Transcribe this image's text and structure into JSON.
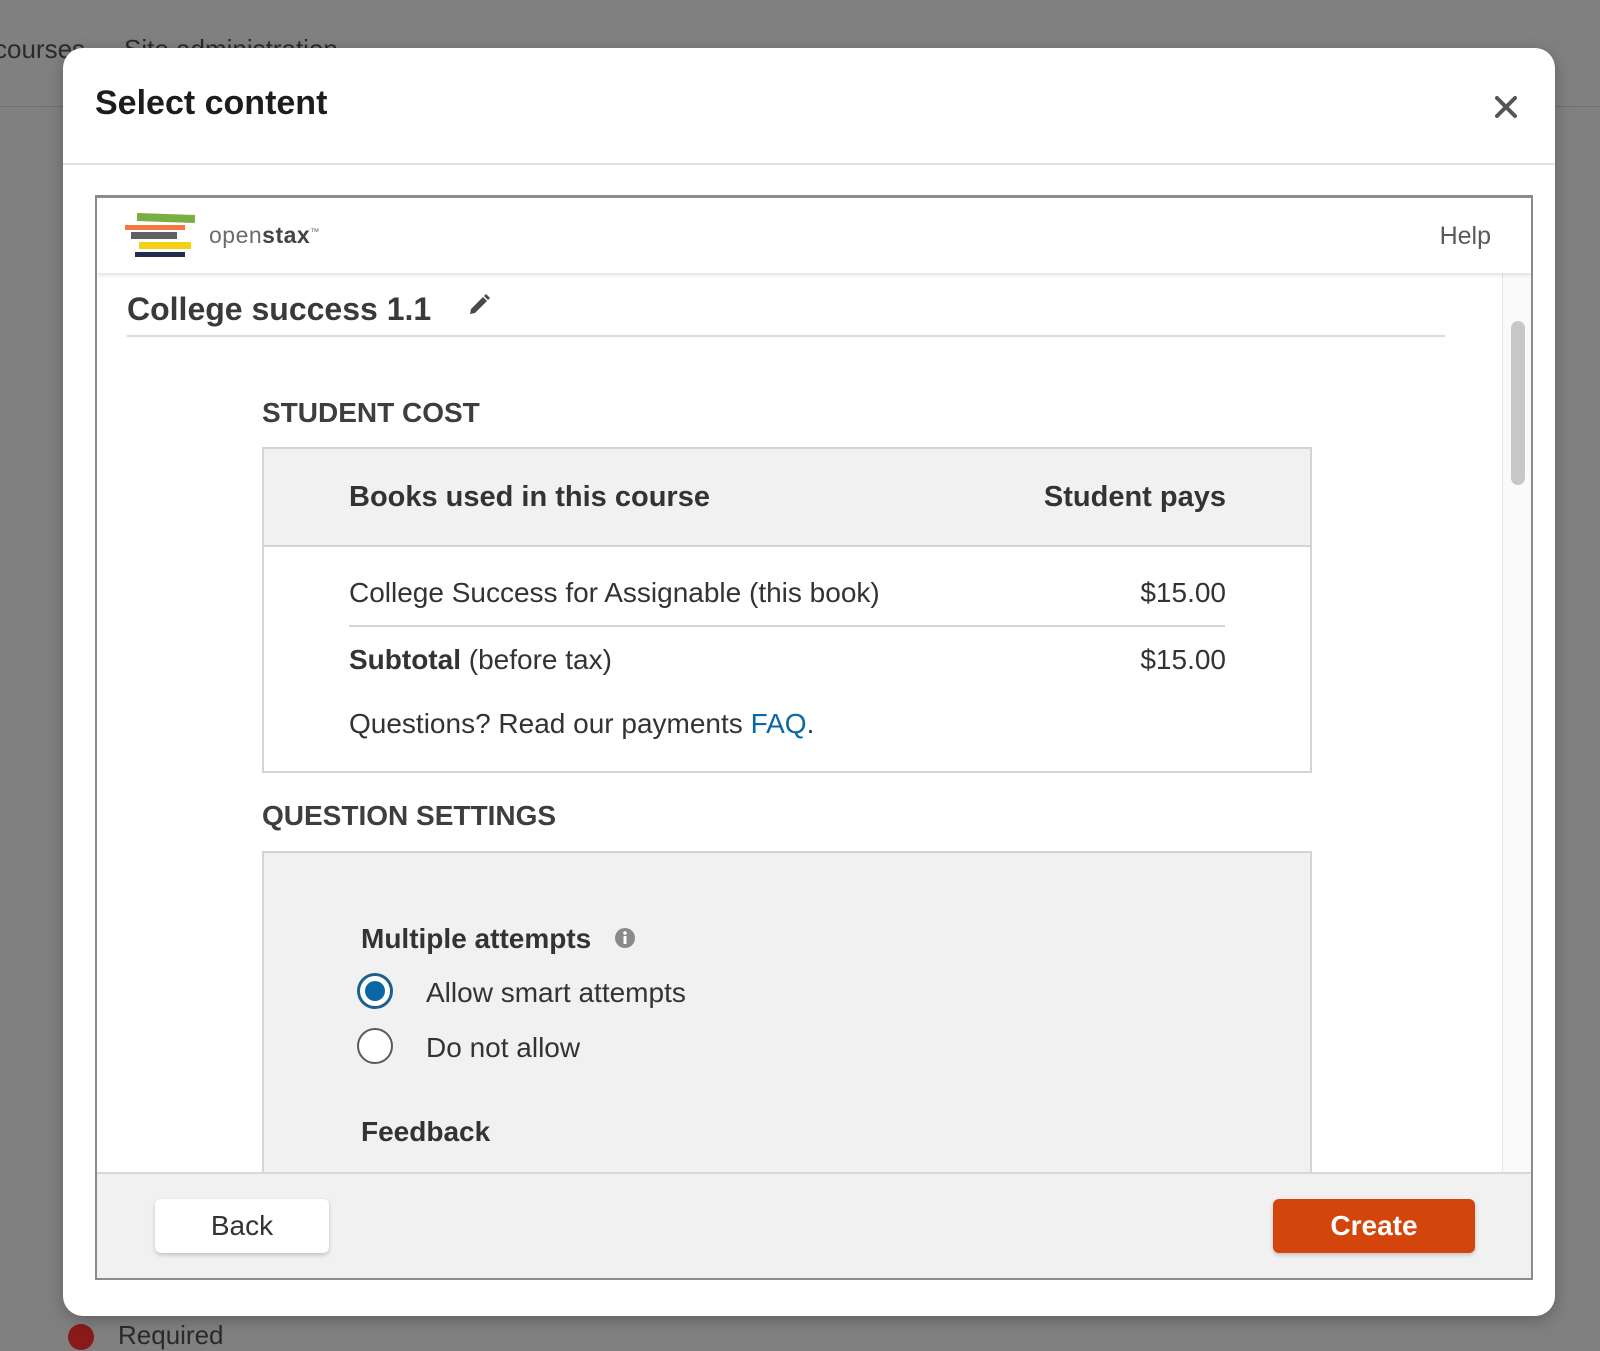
{
  "background": {
    "nav_items": [
      "courses",
      "Site administration"
    ],
    "required_note": "Required"
  },
  "modal": {
    "title": "Select content",
    "close_icon": "close-icon"
  },
  "openstax": {
    "logo_text_light": "open",
    "logo_text_bold": "stax",
    "trademark": "™",
    "help_label": "Help"
  },
  "course": {
    "title": "College success 1.1",
    "edit_icon": "pencil-icon"
  },
  "student_cost": {
    "heading": "STUDENT COST",
    "columns": [
      "Books used in this course",
      "Student pays"
    ],
    "rows": [
      {
        "book": "College Success for Assignable (this book)",
        "price": "$15.00"
      }
    ],
    "subtotal_label": "Subtotal",
    "subtotal_suffix": " (before tax)",
    "subtotal_value": "$15.00",
    "questions_text": "Questions? Read our payments ",
    "faq_label": "FAQ",
    "faq_suffix": "."
  },
  "question_settings": {
    "heading": "QUESTION SETTINGS",
    "multiple_attempts_label": "Multiple attempts",
    "options": [
      {
        "label": "Allow smart attempts",
        "selected": true
      },
      {
        "label": "Do not allow",
        "selected": false
      }
    ],
    "feedback_label": "Feedback"
  },
  "footer": {
    "back_label": "Back",
    "create_label": "Create"
  },
  "colors": {
    "create_button": "#d4450c",
    "link": "#0a67a3",
    "radio_selected": "#0a67a3"
  }
}
